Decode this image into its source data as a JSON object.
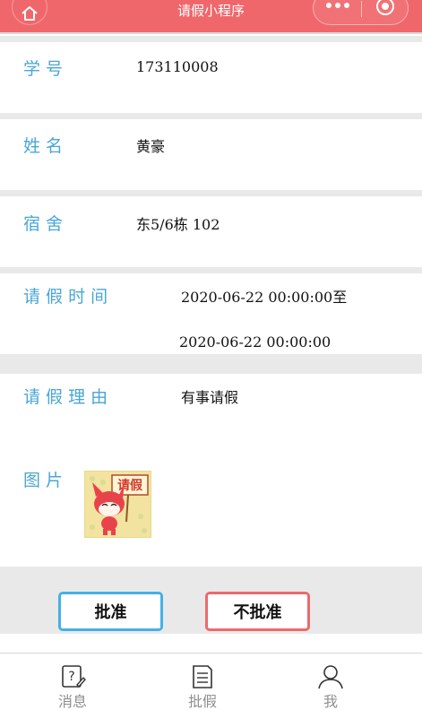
{
  "navbar": {
    "title": "请假小程序",
    "home_icon": "home-icon",
    "more_icon": "more-dots-icon",
    "close_icon": "target-circle-icon",
    "background": "#f0676b"
  },
  "fields": {
    "student_id": {
      "label": "学 号",
      "value": "173110008"
    },
    "name": {
      "label": "姓 名",
      "value": "黄豪"
    },
    "dorm": {
      "label": "宿 舍",
      "value": "东5/6栋 102"
    },
    "leave_time": {
      "label": "请 假 时 间",
      "start": "2020-06-22 00:00:00至",
      "end": "2020-06-22 00:00:00"
    },
    "leave_reason": {
      "label": "请 假 理 由",
      "value": "有事请假"
    },
    "image": {
      "label": "图 片",
      "sign_text": "请假"
    }
  },
  "actions": {
    "approve_label": "批准",
    "reject_label": "不批准",
    "approve_color": "#45b0e5",
    "reject_color": "#ea6a6e"
  },
  "tabbar": {
    "items": [
      {
        "label": "消息",
        "icon": "question-note-icon"
      },
      {
        "label": "批假",
        "icon": "document-icon"
      },
      {
        "label": "我",
        "icon": "user-icon"
      }
    ]
  }
}
